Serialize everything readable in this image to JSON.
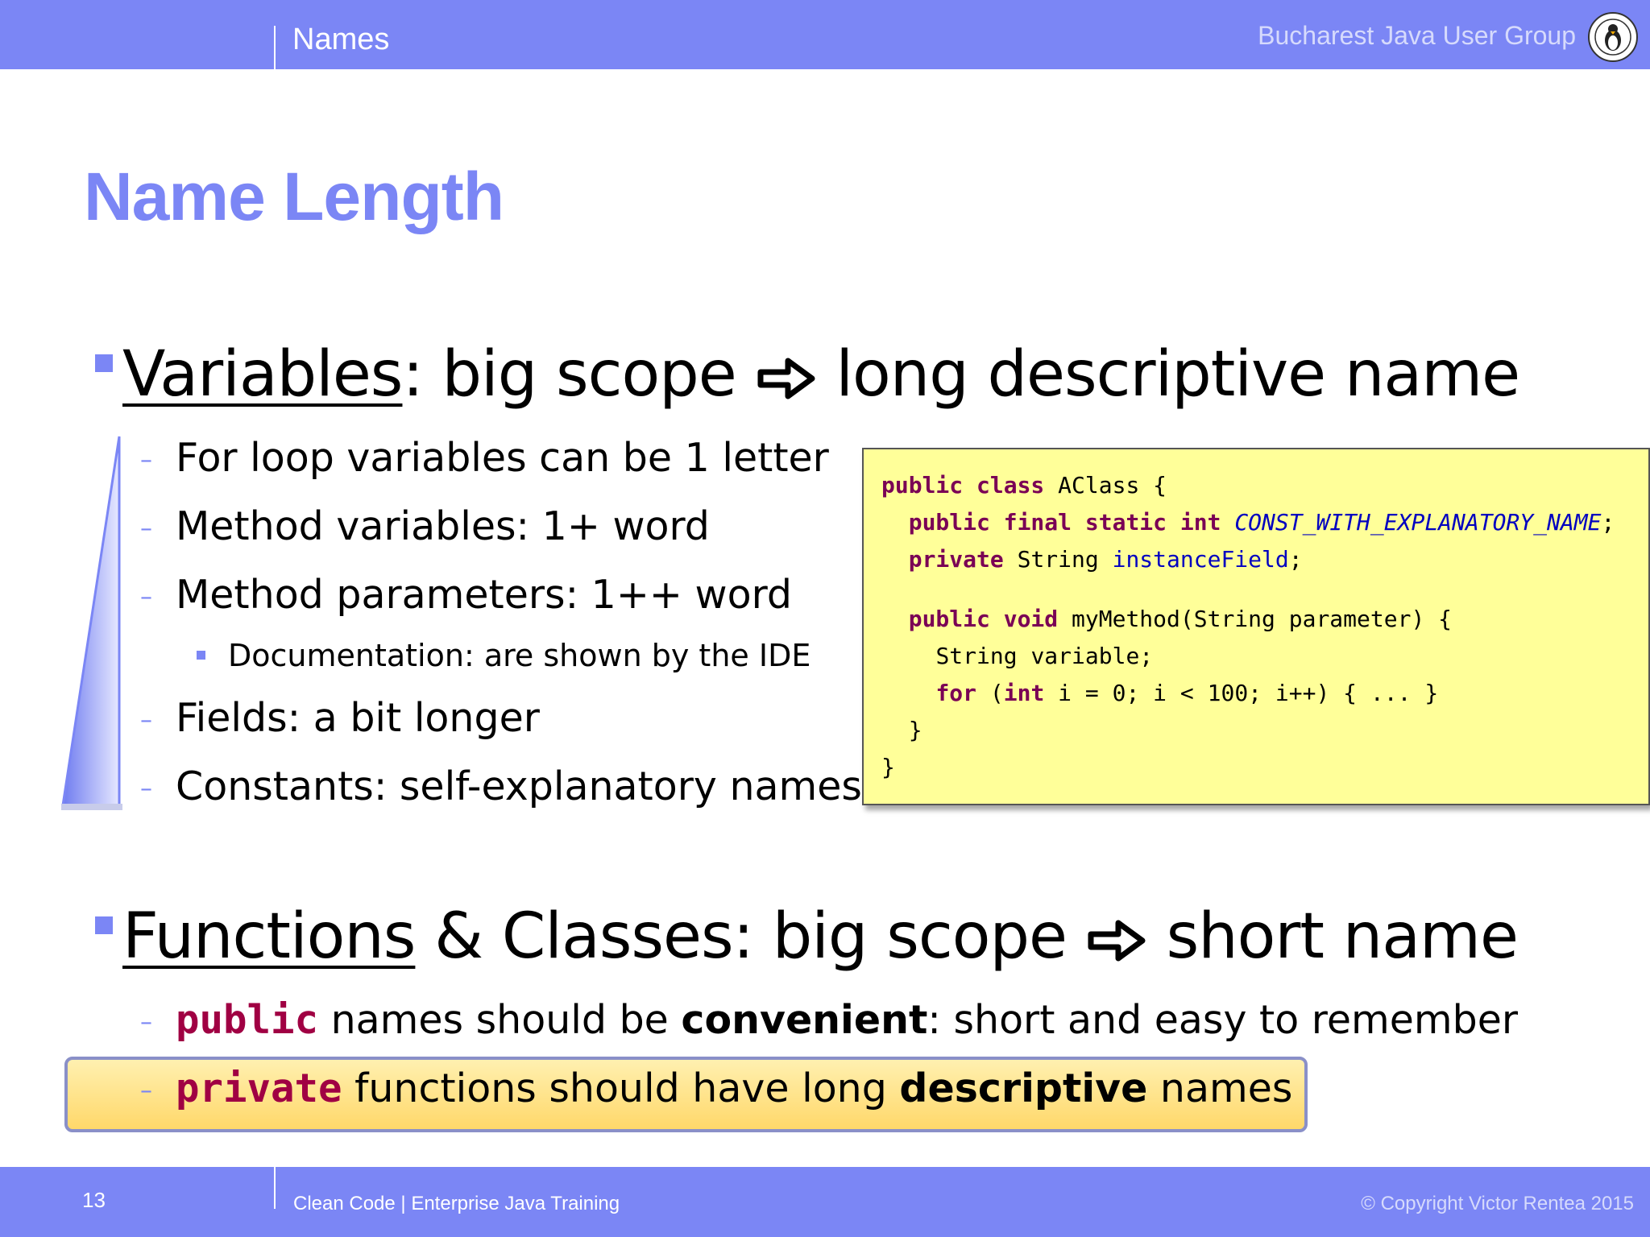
{
  "header": {
    "section": "Names",
    "organization": "Bucharest Java User Group",
    "logo_icon": "jug-penguin-logo"
  },
  "title": "Name Length",
  "variables": {
    "heading_underlined": "Variables",
    "heading_rest_1": ": big scope",
    "arrow_icon": "right-arrow-icon",
    "heading_rest_2": "long descriptive name",
    "items": [
      "For loop variables can be 1 letter",
      "Method variables: 1+ word",
      "Method parameters: 1++ word",
      "Fields: a bit longer",
      "Constants: self-explanatory names"
    ],
    "sub_item": "Documentation: are shown by the IDE"
  },
  "code": {
    "line1_kw": "public class",
    "line1_rest": " AClass {",
    "line2_kw": "public final static int",
    "line2_const": "CONST_WITH_EXPLANATORY_NAME",
    "line2_end": ";",
    "line3_kw": "private",
    "line3_type": " String ",
    "line3_field": "instanceField",
    "line3_end": ";",
    "line4_kw": "public void",
    "line4_rest": " myMethod(String parameter) {",
    "line5": "String variable;",
    "line6_kw1": "for",
    "line6_p1": " (",
    "line6_kw2": "int",
    "line6_rest": " i = 0; i < 100; i++) { ... }",
    "line7": "}",
    "line8": "}"
  },
  "functions": {
    "heading_underlined": "Functions",
    "heading_rest_1": " & Classes: big scope",
    "heading_rest_2": "short name",
    "item1_kw": "public",
    "item1_text1": " names should be ",
    "item1_bold": "convenient",
    "item1_text2": ": short and easy to remember",
    "item2_kw": "private",
    "item2_text1": " functions should have long ",
    "item2_bold": "descriptive",
    "item2_text2": " names"
  },
  "footer": {
    "page_number": "13",
    "course": "Clean Code | Enterprise Java Training",
    "copyright": "© Copyright Victor Rentea 2015"
  },
  "colors": {
    "accent": "#7b86f5",
    "keyword": "#a00043",
    "code_bg": "#ffff99",
    "highlight": "#ffe08a"
  }
}
